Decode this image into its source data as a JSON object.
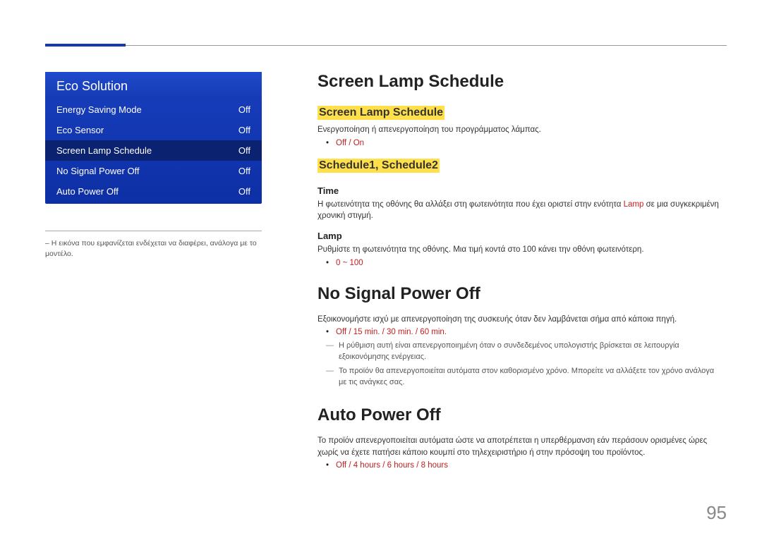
{
  "pageNumber": "95",
  "sidebar": {
    "menuTitle": "Eco Solution",
    "items": [
      {
        "label": "Energy Saving Mode",
        "value": "Off"
      },
      {
        "label": "Eco Sensor",
        "value": "Off"
      },
      {
        "label": "Screen Lamp Schedule",
        "value": "Off"
      },
      {
        "label": "No Signal Power Off",
        "value": "Off"
      },
      {
        "label": "Auto Power Off",
        "value": "Off"
      }
    ],
    "footnote": "Η εικόνα που εμφανίζεται ενδέχεται να διαφέρει, ανάλογα με το μοντέλο."
  },
  "content": {
    "sls": {
      "h1": "Screen Lamp Schedule",
      "h2": "Screen Lamp Schedule",
      "desc": "Ενεργοποίηση ή απενεργοποίηση του προγράμματος λάμπας.",
      "bullet": "Off / On",
      "sched_h2": "Schedule1, Schedule2",
      "time_h3": "Time",
      "time_desc_pre": "Η φωτεινότητα της οθόνης θα αλλάξει στη φωτεινότητα που έχει οριστεί στην ενότητα ",
      "time_desc_red": "Lamp",
      "time_desc_post": " σε μια συγκεκριμένη χρονική στιγμή.",
      "lamp_h3": "Lamp",
      "lamp_desc": "Ρυθμίστε τη φωτεινότητα της οθόνης. Μια τιμή κοντά στο 100 κάνει την οθόνη φωτεινότερη.",
      "lamp_bullet": "0 ~ 100"
    },
    "nspo": {
      "h1": "No Signal Power Off",
      "desc": "Εξοικονομήστε ισχύ με απενεργοποίηση της συσκευής όταν δεν λαμβάνεται σήμα από κάποια πηγή.",
      "bullet": "Off / 15 min. / 30 min. / 60 min.",
      "dash1": "Η ρύθμιση αυτή είναι απενεργοποιημένη όταν ο συνδεδεμένος υπολογιστής βρίσκεται σε λειτουργία εξοικονόμησης ενέργειας.",
      "dash2": "Το προϊόν θα απενεργοποιείται αυτόματα στον καθορισμένο χρόνο. Μπορείτε να αλλάξετε τον χρόνο ανάλογα με τις ανάγκες σας."
    },
    "apo": {
      "h1": "Auto Power Off",
      "desc": "Το προϊόν απενεργοποιείται αυτόματα ώστε να αποτρέπεται η υπερθέρμανση εάν περάσουν ορισμένες ώρες χωρίς να έχετε πατήσει κάποιο κουμπί στο τηλεχειριστήριο ή στην πρόσοψη του προϊόντος.",
      "bullet": "Off / 4 hours / 6 hours / 8 hours"
    }
  }
}
